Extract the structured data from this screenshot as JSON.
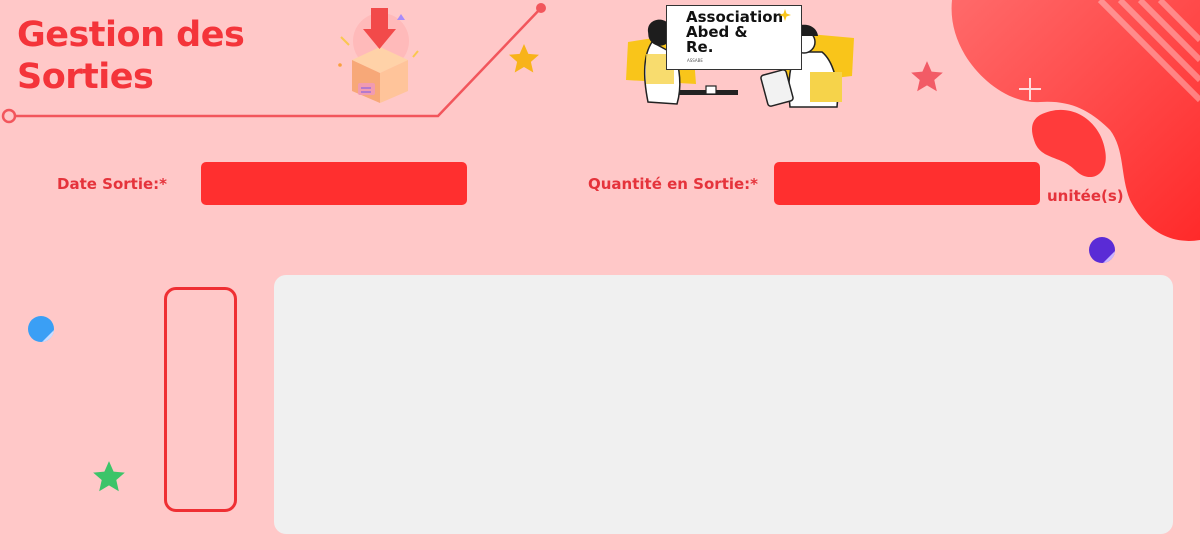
{
  "header": {
    "title_line1": "Gestion des",
    "title_line2": "Sorties"
  },
  "logo": {
    "line1": "Association",
    "line2": "Abed &",
    "line3": "Re.",
    "tagline": "ASSABE"
  },
  "form": {
    "date_label": "Date Sortie:*",
    "date_value": "",
    "quantity_label": "Quantité en Sortie:*",
    "quantity_value": "",
    "unit_label": "unitée(s)"
  },
  "colors": {
    "background": "#ffc8c8",
    "accent": "#ff2f2f",
    "title": "#f4343a",
    "panel": "#f0f0f0"
  },
  "icons": [
    "download-box-icon",
    "star-icon",
    "sparkle-icon",
    "dot-icon"
  ]
}
